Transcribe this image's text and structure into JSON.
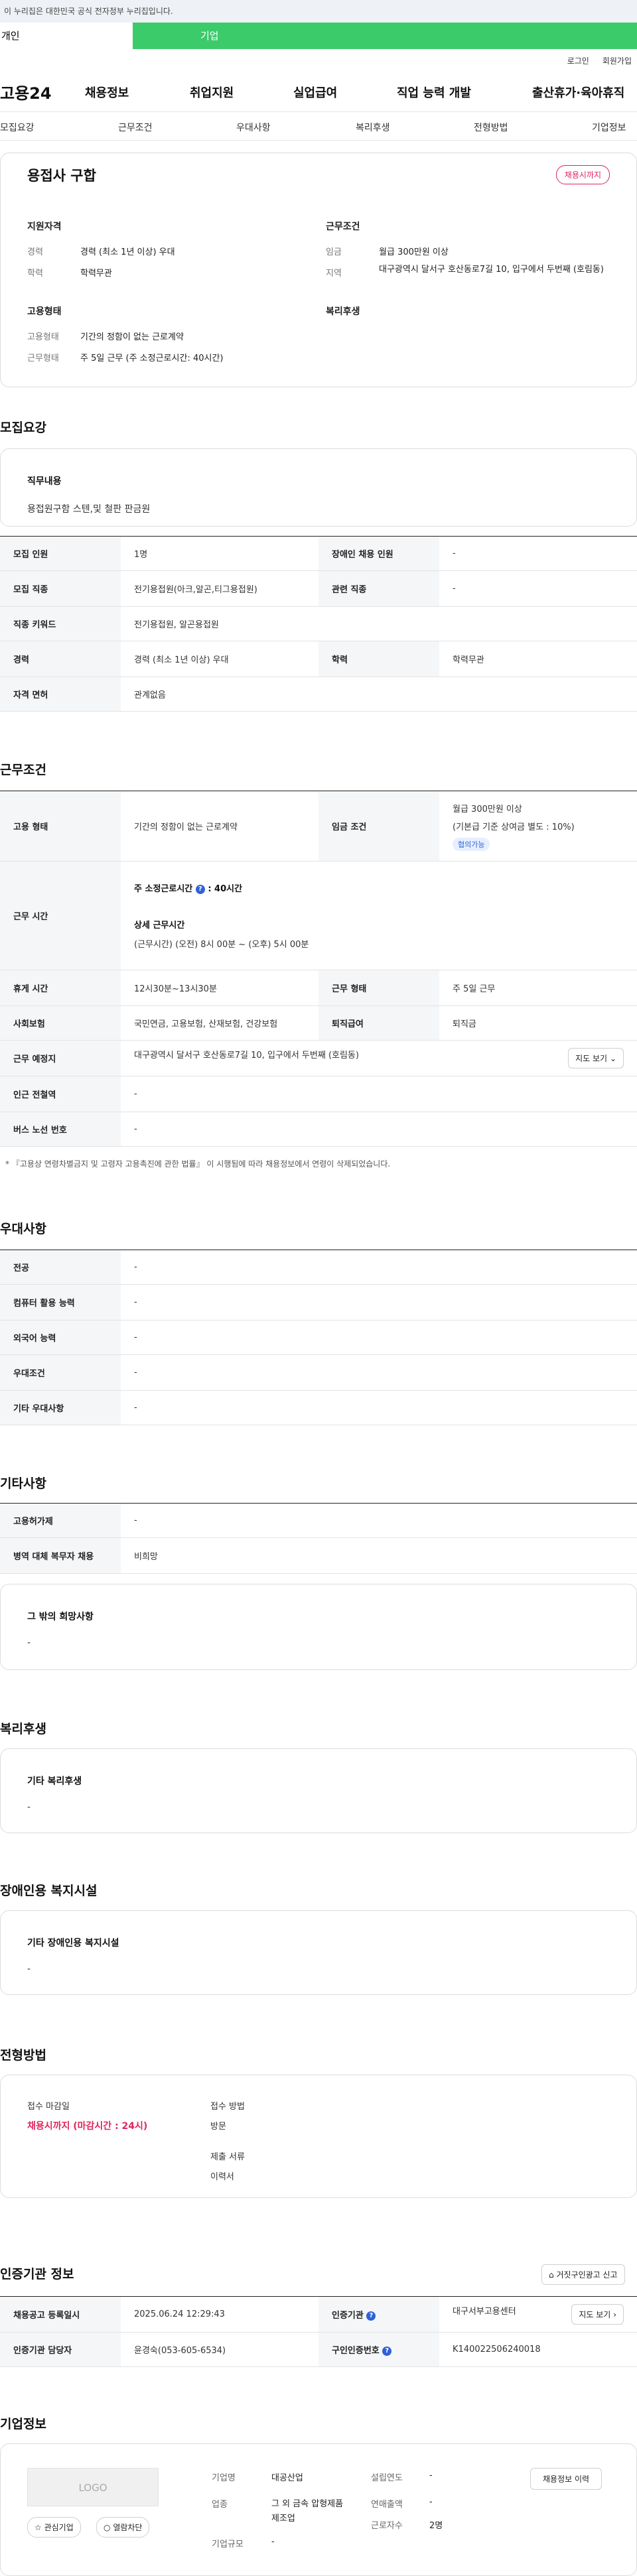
{
  "gov_banner": "이 누리집은 대한민국 공식 전자정부 누리집입니다.",
  "customer_tabs": {
    "person": "개인",
    "company": "기업"
  },
  "util": {
    "login": "로그인",
    "join": "회원가입"
  },
  "gnb": {
    "logo": "고용24",
    "items": [
      "채용정보",
      "취업지원",
      "실업급여",
      "직업 능력 개발",
      "출산휴가·육아휴직"
    ]
  },
  "subnav": [
    "모집요강",
    "근무조건",
    "우대사항",
    "복리후생",
    "전형방법",
    "기업정보"
  ],
  "summary": {
    "title": "용접사 구합",
    "status": "채용시까지",
    "qual_title": "지원자격",
    "career_k": "경력",
    "career_v": "경력 (최소 1년 이상) 우대",
    "edu_k": "학력",
    "edu_v": "학력무관",
    "work_title": "근무조건",
    "wage_k": "임금",
    "wage_v": "월급 300만원 이상",
    "area_k": "지역",
    "area_v": "대구광역시 달서구 호산동로7길 10, 입구에서 두번째 (호림동)",
    "emp_title": "고용형태",
    "emp_type_k": "고용형태",
    "emp_type_v": "기간의 정함이 없는 근로계약",
    "emp_hours_k": "근무형태",
    "emp_hours_v": "주 5일 근무 (주 소정근로시간: 40시간)",
    "welfare_title": "복리후생"
  },
  "recruit": {
    "title": "모집요강",
    "duty_label": "직무내용",
    "duty_value": "용접원구함 스텐,및 철판 판금원",
    "rows": {
      "count_k": "모집 인원",
      "count_v": "1명",
      "disabled_k": "장애인 채용 인원",
      "disabled_v": "-",
      "job_k": "모집 직종",
      "job_v": "전기용접원(아크,알곤,티그용접원)",
      "rel_k": "관련 직종",
      "rel_v": "-",
      "kw_k": "직종 키워드",
      "kw_v": "전기용접원, 알곤용접원",
      "career_k": "경력",
      "career_v": "경력 (최소 1년 이상) 우대",
      "edu_k": "학력",
      "edu_v": "학력무관",
      "license_k": "자격 면허",
      "license_v": "관계없음"
    }
  },
  "work": {
    "title": "근무조건",
    "emp_k": "고용 형태",
    "emp_v": "기간의 정함이 없는 근로계약",
    "wage_k": "임금 조건",
    "wage_v1": "월급 300만원 이상",
    "wage_v2": "(기본급 기준 상여금 별도 : 10%)",
    "wage_badge": "협의가능",
    "time_k": "근무 시간",
    "time_main": "주 소정근로시간",
    "time_main_v": ": 40시간",
    "time_detail_title": "상세 근무시간",
    "time_detail": "(근무시간) (오전) 8시 00분 ~ (오후) 5시 00분",
    "rest_k": "휴게 시간",
    "rest_v": "12시30분~13시30분",
    "form_k": "근무 형태",
    "form_v": "주 5일 근무",
    "ins_k": "사회보험",
    "ins_v": "국민연금, 고용보험, 산재보험, 건강보험",
    "sev_k": "퇴직급여",
    "sev_v": "퇴직금",
    "place_k": "근무 예정지",
    "place_v": "대구광역시 달서구 호산동로7길 10, 입구에서 두번째 (호림동)",
    "map_btn": "지도 보기",
    "subway_k": "인근 전철역",
    "subway_v": "-",
    "bus_k": "버스 노선 번호",
    "bus_v": "-",
    "note": "* 『고용상 연령차별금지 및 고령자 고용촉진에 관한 법률』 이 시행됨에 따라 채용정보에서 연령이 삭제되었습니다."
  },
  "prefer": {
    "title": "우대사항",
    "rows": [
      [
        "전공",
        "-"
      ],
      [
        "컴퓨터 활용 능력",
        "-"
      ],
      [
        "외국어 능력",
        "-"
      ],
      [
        "우대조건",
        "-"
      ],
      [
        "기타 우대사항",
        "-"
      ]
    ]
  },
  "etc": {
    "title": "기타사항",
    "rows": [
      [
        "고용허가제",
        "-"
      ],
      [
        "병역 대체 복무자 채용",
        "비희망"
      ]
    ],
    "other_label": "그 밖의 희망사항",
    "other_value": "-"
  },
  "welfare": {
    "title": "복리후생",
    "label": "기타 복리후생",
    "value": "-"
  },
  "disabled_fac": {
    "title": "장애인용 복지시설",
    "label": "기타 장애인용 복지시설",
    "value": "-"
  },
  "selection": {
    "title": "전형방법",
    "deadline_k": "접수 마감일",
    "deadline_v": "채용시까지 (마감시간 : 24시)",
    "method_k": "접수 방법",
    "method_v": "방문",
    "docs_k": "제출 서류",
    "docs_v": "이력서"
  },
  "cert": {
    "title": "인증기관 정보",
    "report_btn": "거짓구인광고 신고",
    "reg_k": "채용공고 등록일시",
    "reg_v": "2025.06.24 12:29:43",
    "org_k": "인증기관",
    "org_v": "대구서부고용센터",
    "map_btn": "지도 보기",
    "mgr_k": "인증기관 담당자",
    "mgr_v": "윤경숙(053-605-6534)",
    "no_k": "구인인증번호",
    "no_v": "K140022506240018"
  },
  "company": {
    "title": "기업정보",
    "logo": "LOGO",
    "fav_btn": "관심기업",
    "block_btn": "열람차단",
    "history_btn": "채용정보 이력",
    "name_k": "기업명",
    "name_v": "대공산업",
    "ind_k": "업종",
    "ind_v": "그 외 금속 압형제품 제조업",
    "size_k": "기업규모",
    "size_v": "-",
    "year_k": "설립연도",
    "year_v": "-",
    "sales_k": "연매출액",
    "sales_v": "-",
    "emp_k": "근로자수",
    "emp_v": "2명"
  },
  "colors": {
    "accent_green": "#3ccb6b",
    "status_pink": "#e0245e",
    "blue": "#2f62d6"
  }
}
